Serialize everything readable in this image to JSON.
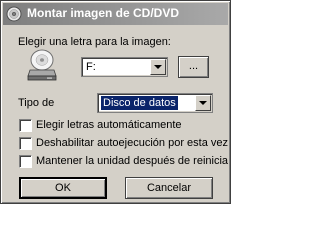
{
  "window": {
    "title": "Montar imagen de CD/DVD",
    "icon": "cd-dvd-icon"
  },
  "drive": {
    "label": "Elegir una letra para la imagen:",
    "value": "F:",
    "browse_label": "..."
  },
  "type": {
    "label": "Tipo de",
    "value": "Disco de datos"
  },
  "options": [
    {
      "label": "Elegir letras automáticamente",
      "checked": false
    },
    {
      "label": "Deshabilitar autoejecución por esta vez",
      "checked": false
    },
    {
      "label": "Mantener la unidad después de  reinicia",
      "checked": false
    }
  ],
  "buttons": {
    "ok": "OK",
    "cancel": "Cancelar"
  }
}
